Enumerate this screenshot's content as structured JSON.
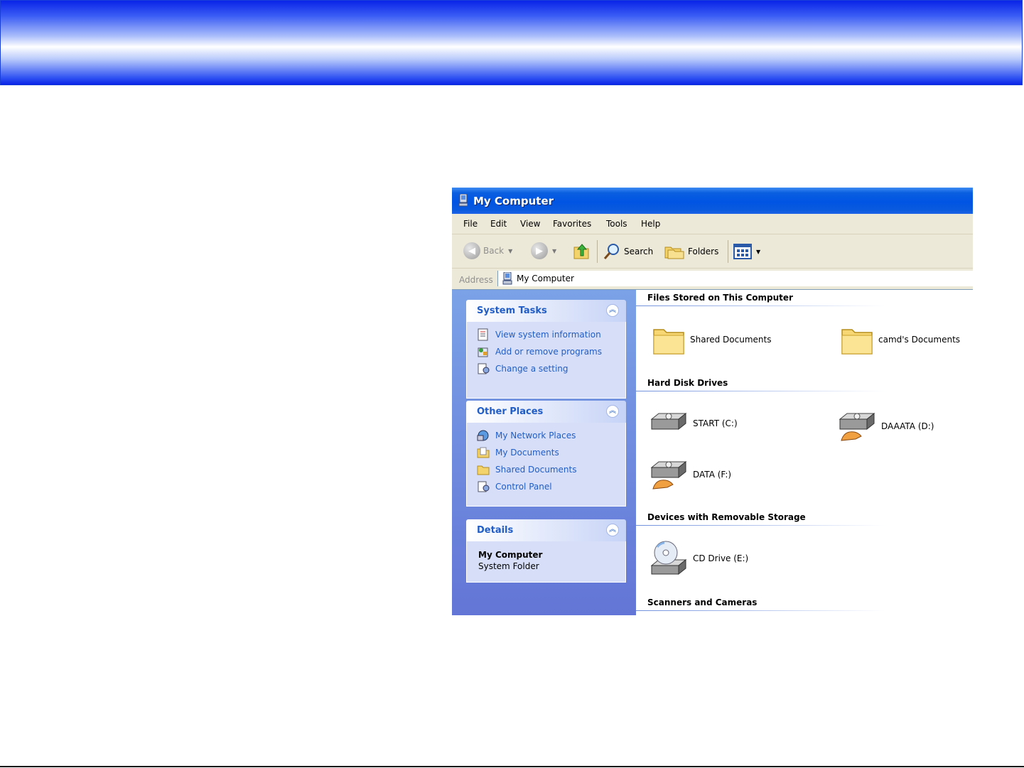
{
  "window": {
    "title": "My Computer"
  },
  "menu": [
    "File",
    "Edit",
    "View",
    "Favorites",
    "Tools",
    "Help"
  ],
  "toolbar": {
    "back": "Back",
    "search": "Search",
    "folders": "Folders"
  },
  "address": {
    "label": "Address",
    "value": "My Computer"
  },
  "system_tasks": {
    "title": "System Tasks",
    "items": [
      "View system information",
      "Add or remove programs",
      "Change a setting"
    ]
  },
  "other_places": {
    "title": "Other Places",
    "items": [
      "My Network Places",
      "My Documents",
      "Shared Documents",
      "Control Panel"
    ]
  },
  "details": {
    "title": "Details",
    "name": "My Computer",
    "type": "System Folder"
  },
  "groups": {
    "files": {
      "title": "Files Stored on This Computer",
      "items": [
        "Shared Documents",
        "camd's Documents"
      ]
    },
    "hard_disks": {
      "title": "Hard Disk Drives",
      "items": [
        "START (C:)",
        "DAAATA (D:)",
        "DATA (F:)"
      ]
    },
    "removable": {
      "title": "Devices with Removable Storage",
      "items": [
        "CD Drive (E:)"
      ]
    },
    "scanners": {
      "title": "Scanners and Cameras"
    }
  }
}
